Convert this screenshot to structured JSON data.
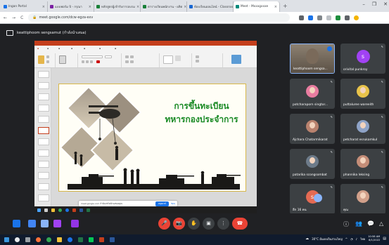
{
  "browser": {
    "tabs": [
      {
        "label": "Ingan Portal",
        "color": "#1a73e8"
      },
      {
        "label": "แบบฟอร์ม ปี - กรุณา",
        "color": "#7b1fa2"
      },
      {
        "label": "หลักสูตรผู้เข้ารับการอบรม",
        "color": "#188038"
      },
      {
        "label": "ตารางเรียนพนักงาน - ผลิต",
        "color": "#188038"
      },
      {
        "label": "ห้องเรียนออนไลน์ - Classroom",
        "color": "#1967d2"
      },
      {
        "label": "Meet - Mxxxgxxxe",
        "color": "#00897b",
        "active": true
      }
    ],
    "new_tab": "+",
    "window_controls": [
      "–",
      "❐",
      "✕"
    ],
    "url": "meet.google.com/dcw-egza-exv",
    "nav": [
      "←",
      "→",
      "C",
      "⌂"
    ]
  },
  "meet": {
    "presenter_label": "keattiphoom sengsamut (กำลังนำเสนอ)",
    "share_banner": {
      "text": "meet.google.com กำลังแชร์หน้าจอของคุณ",
      "stop_label": "หยุดแชร์",
      "hide_label": "ซ่อน"
    },
    "participants": [
      {
        "name": "keattiphoom sengsa...",
        "kind": "video",
        "avatar_color": "#7a6a5a"
      },
      {
        "name": "orivital punkroy",
        "kind": "letter",
        "letter": "s",
        "avatar_color": "#a142f4"
      },
      {
        "name": "potcharaporn singtor...",
        "kind": "photo",
        "avatar_color": "#e87ca0"
      },
      {
        "name": "puttaluree wareeith",
        "kind": "photo",
        "avatar_color": "#e8c34a"
      },
      {
        "name": "Ajchara Chatarmikarat",
        "kind": "photo",
        "avatar_color": "#b9826e"
      },
      {
        "name": "petcharat esrukamkul",
        "kind": "photo",
        "avatar_color": "#8ea3c7"
      },
      {
        "name": "patarika scongsombat",
        "kind": "photo",
        "avatar_color": "#6d7b8a"
      },
      {
        "name": "phannika leksing",
        "kind": "photo",
        "avatar_color": "#c48d78"
      },
      {
        "name": "อีก 16 คน",
        "kind": "group",
        "letter": "s",
        "avatar_color": "#e46a53"
      },
      {
        "name": "คุณ",
        "kind": "photo",
        "avatar_color": "#d1a08a"
      }
    ],
    "controls": {
      "mic_icon": "🎤",
      "camera_icon": "📷",
      "raise_hand_icon": "✋",
      "present_icon": "▣",
      "more_icon": "⋮",
      "hangup_icon": "☎"
    },
    "right_icons": [
      "ⓘ",
      "👥",
      "💬",
      "△"
    ]
  },
  "slide": {
    "title_line1": "การขึ้นทะเบียน",
    "title_line2": "ทหารกองประจำการ"
  },
  "taskbar": {
    "weather": "30°C มีแดดเป็นส่วนใหญ่",
    "language": "ไทย",
    "time": "10:58 AM",
    "date": "8/1/2022"
  },
  "colors": {
    "accent": "#1a73e8",
    "ppt_red": "#c43e1c",
    "slide_title": "#1a8a25",
    "danger": "#ea4335"
  }
}
